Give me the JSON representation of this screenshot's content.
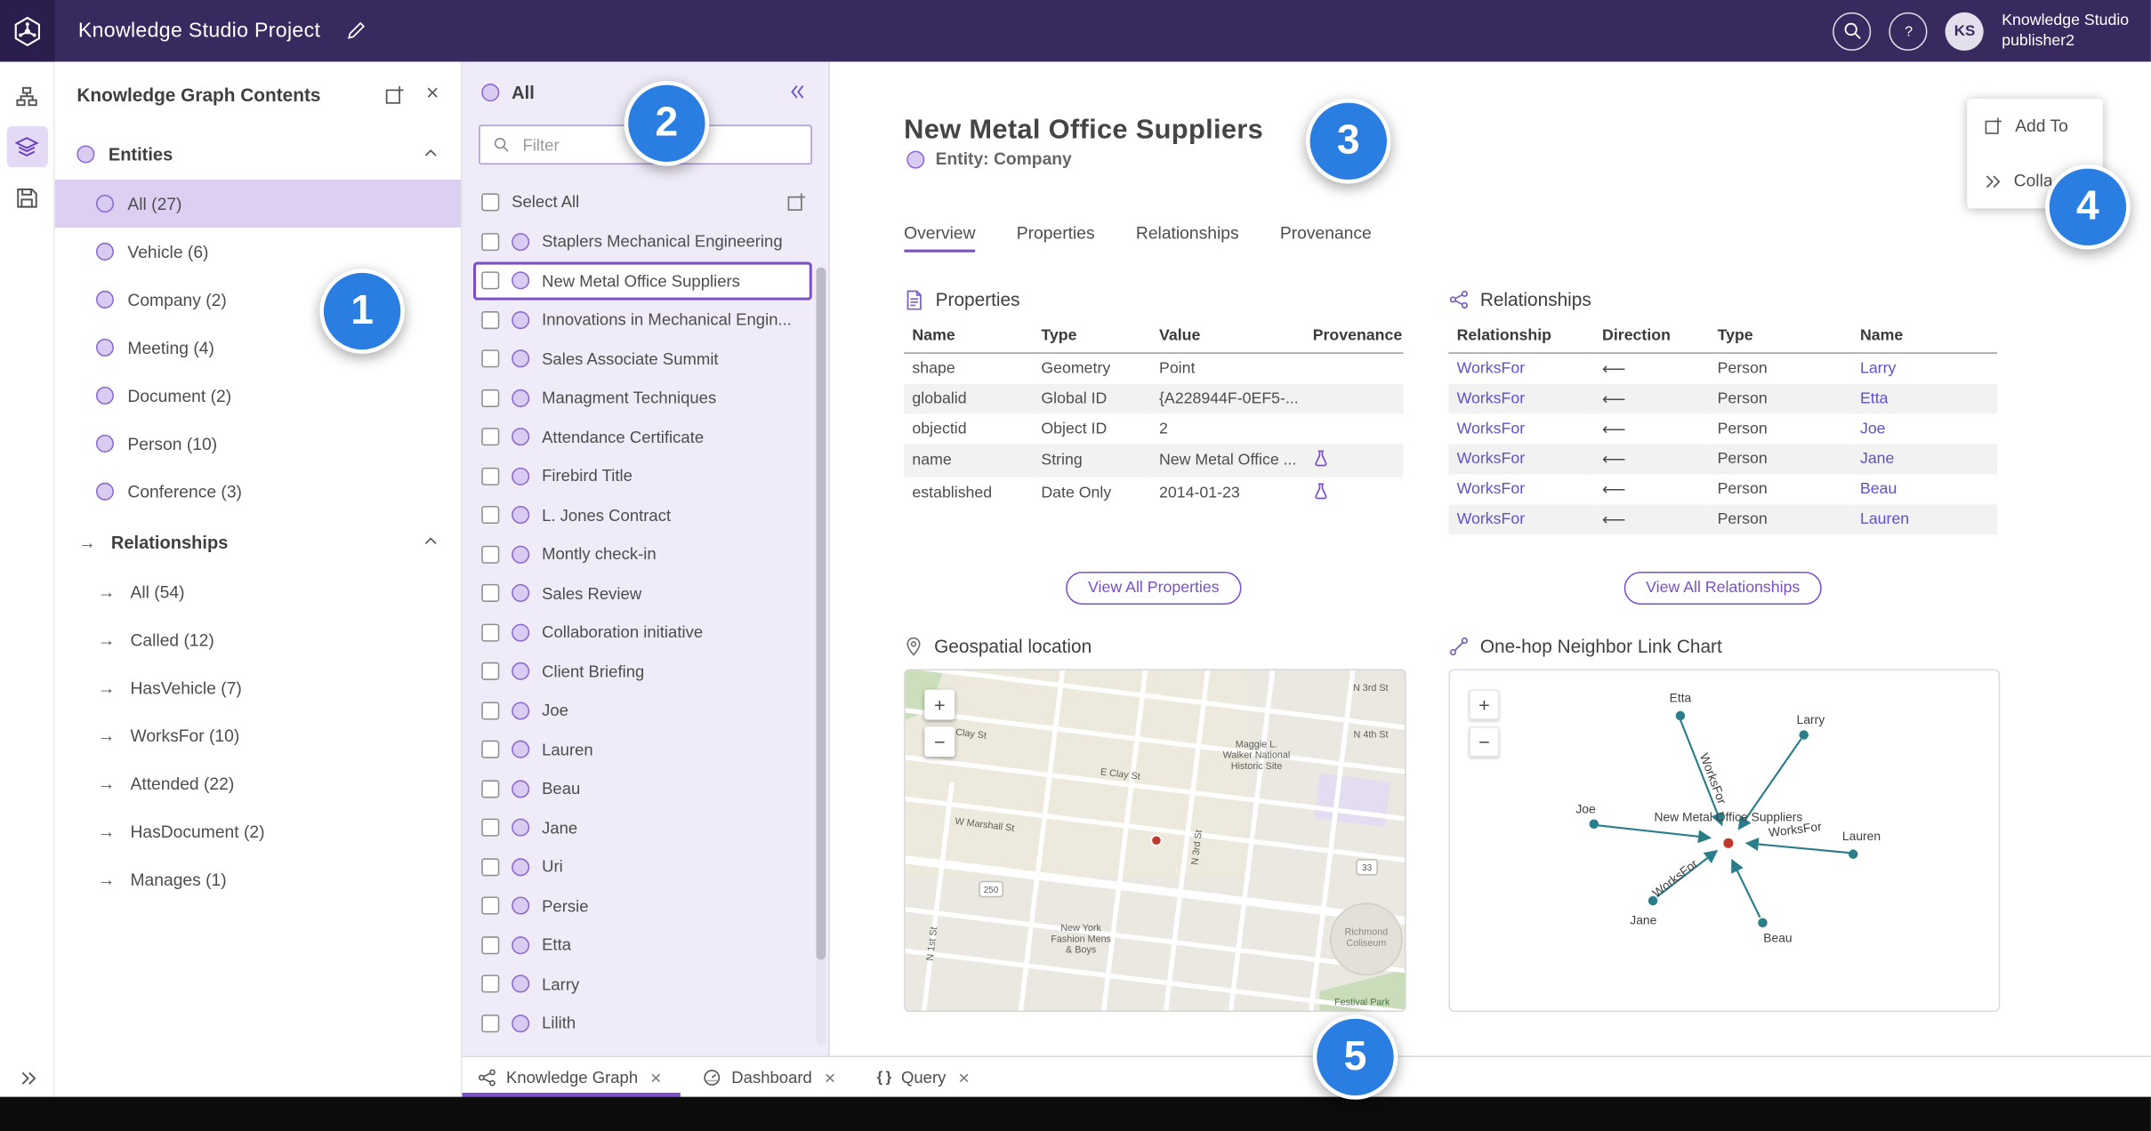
{
  "topbar": {
    "title": "Knowledge Studio Project",
    "avatar_initials": "KS",
    "user_org": "Knowledge Studio",
    "user_name": "publisher2"
  },
  "contents_panel": {
    "title": "Knowledge Graph Contents",
    "entities_label": "Entities",
    "entities": [
      "All (27)",
      "Vehicle (6)",
      "Company (2)",
      "Meeting (4)",
      "Document (2)",
      "Person (10)",
      "Conference (3)"
    ],
    "relationships_label": "Relationships",
    "relationships": [
      "All (54)",
      "Called (12)",
      "HasVehicle (7)",
      "WorksFor (10)",
      "Attended (22)",
      "HasDocument (2)",
      "Manages (1)"
    ]
  },
  "list_panel": {
    "header": "All",
    "filter_placeholder": "Filter",
    "select_all_label": "Select All",
    "items": [
      "Staplers Mechanical Engineering",
      "New Metal Office Suppliers",
      "Innovations in Mechanical Engin...",
      "Sales Associate Summit",
      "Managment Techniques",
      "Attendance Certificate",
      "Firebird Title",
      "L. Jones Contract",
      "Montly check-in",
      "Sales Review",
      "Collaboration initiative",
      "Client Briefing",
      "Joe",
      "Lauren",
      "Beau",
      "Jane",
      "Uri",
      "Persie",
      "Etta",
      "Larry",
      "Lilith"
    ]
  },
  "detail": {
    "title": "New Metal Office Suppliers",
    "entity_label": "Entity: Company",
    "tabs": [
      "Overview",
      "Properties",
      "Relationships",
      "Provenance"
    ],
    "properties": {
      "heading": "Properties",
      "columns": [
        "Name",
        "Type",
        "Value",
        "Provenance"
      ],
      "rows": [
        {
          "name": "shape",
          "type": "Geometry",
          "value": "Point",
          "prov": false
        },
        {
          "name": "globalid",
          "type": "Global ID",
          "value": "{A228944F-0EF5-...",
          "prov": false
        },
        {
          "name": "objectid",
          "type": "Object ID",
          "value": "2",
          "prov": false
        },
        {
          "name": "name",
          "type": "String",
          "value": "New Metal Office ...",
          "prov": true
        },
        {
          "name": "established",
          "type": "Date Only",
          "value": "2014-01-23",
          "prov": true
        }
      ],
      "view_all_label": "View All Properties"
    },
    "relationships": {
      "heading": "Relationships",
      "columns": [
        "Relationship",
        "Direction",
        "Type",
        "Name"
      ],
      "rows": [
        {
          "rel": "WorksFor",
          "dir": "⟵",
          "type": "Person",
          "name": "Larry"
        },
        {
          "rel": "WorksFor",
          "dir": "⟵",
          "type": "Person",
          "name": "Etta"
        },
        {
          "rel": "WorksFor",
          "dir": "⟵",
          "type": "Person",
          "name": "Joe"
        },
        {
          "rel": "WorksFor",
          "dir": "⟵",
          "type": "Person",
          "name": "Jane"
        },
        {
          "rel": "WorksFor",
          "dir": "⟵",
          "type": "Person",
          "name": "Beau"
        },
        {
          "rel": "WorksFor",
          "dir": "⟵",
          "type": "Person",
          "name": "Lauren"
        }
      ],
      "view_all_label": "View All Relationships"
    },
    "geospatial": {
      "heading": "Geospatial location"
    },
    "link_chart": {
      "heading": "One-hop Neighbor Link Chart",
      "center": "New Metal Office Suppliers",
      "edge_label": "WorksFor",
      "nodes": {
        "etta": "Etta",
        "larry": "Larry",
        "joe": "Joe",
        "lauren": "Lauren",
        "jane": "Jane",
        "beau": "Beau"
      }
    }
  },
  "map": {
    "streets": {
      "w_clay": "W Clay St",
      "e_clay": "E Clay St",
      "w_marshall": "W Marshall St",
      "n_1st": "N 1st St",
      "n_3rd_v": "N 3rd St",
      "n_3rd": "N 3rd St",
      "n_4th": "N 4th St"
    },
    "shields": {
      "s250": "250",
      "s33": "33"
    },
    "maggie": {
      "l1": "Maggie L.",
      "l2": "Walker National",
      "l3": "Historic Site"
    },
    "fashion": {
      "l1": "New York",
      "l2": "Fashion Mens",
      "l3": "& Boys"
    },
    "coliseum": {
      "l1": "Richmond",
      "l2": "Coliseum"
    },
    "festival": "Festival Park"
  },
  "map_controls": {
    "zoom_in": "+",
    "zoom_out": "−"
  },
  "context_menu": {
    "add_to": "Add To",
    "collapse": "Colla"
  },
  "bottom_tabs": [
    {
      "label": "Knowledge Graph"
    },
    {
      "label": "Dashboard"
    },
    {
      "label": "Query"
    }
  ],
  "badges": [
    "1",
    "2",
    "3",
    "4",
    "5"
  ]
}
